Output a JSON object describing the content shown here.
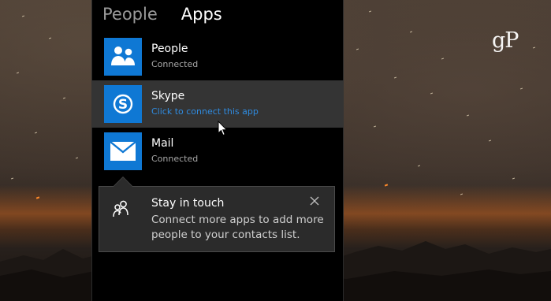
{
  "watermark": "gP",
  "tabs": [
    {
      "label": "People",
      "active": false
    },
    {
      "label": "Apps",
      "active": true
    }
  ],
  "apps": [
    {
      "name": "People",
      "status": "Connected",
      "icon": "people-icon",
      "hovered": false
    },
    {
      "name": "Skype",
      "status": "Click to connect this app",
      "icon": "skype-icon",
      "hovered": true
    },
    {
      "name": "Mail",
      "status": "Connected",
      "icon": "mail-icon",
      "hovered": false
    }
  ],
  "tooltip": {
    "icon": "contacts-icon",
    "title": "Stay in touch",
    "body": "Connect more apps to add more people to your contacts list.",
    "close_icon": "close-icon"
  },
  "colors": {
    "tile_blue": "#0f78d4",
    "link_blue": "#2f8be0",
    "panel_bg": "#000000",
    "hover_bg": "#343434",
    "tooltip_bg": "#2b2b2b"
  }
}
